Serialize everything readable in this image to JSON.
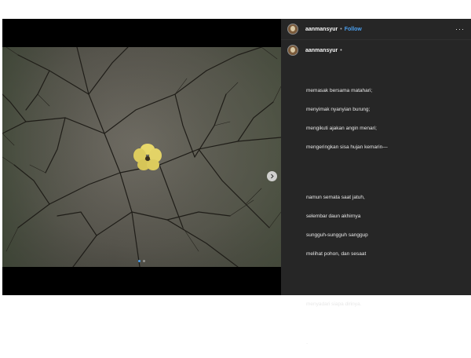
{
  "post": {
    "username": "aanmansyur",
    "header_separator": "•",
    "follow_label": "Follow",
    "more_label": "···"
  },
  "caption": {
    "username": "aanmansyur",
    "user_suffix": "•",
    "stanza1": [
      "memasak bersama matahari;",
      "menyimak nyanyian burung;",
      "mengikuti ajakan angin menari;",
      "mengeringkan sisa hujan kemarin—"
    ],
    "stanza2": [
      "namun semata saat jatuh,",
      "selembar daun akhirnya",
      "sungguh-sungguh sanggup",
      "melihat pohon, dan sesaat"
    ],
    "stanza3": [
      "menyadari siapa dirinya."
    ],
    "end_mark": "."
  },
  "carousel": {
    "total": 2,
    "current": 1
  },
  "colors": {
    "panel_bg": "#262626",
    "link": "#4a9eed",
    "media_bg": "#000000"
  },
  "icons": {
    "next": "chevron-right-icon",
    "more": "more-icon"
  }
}
